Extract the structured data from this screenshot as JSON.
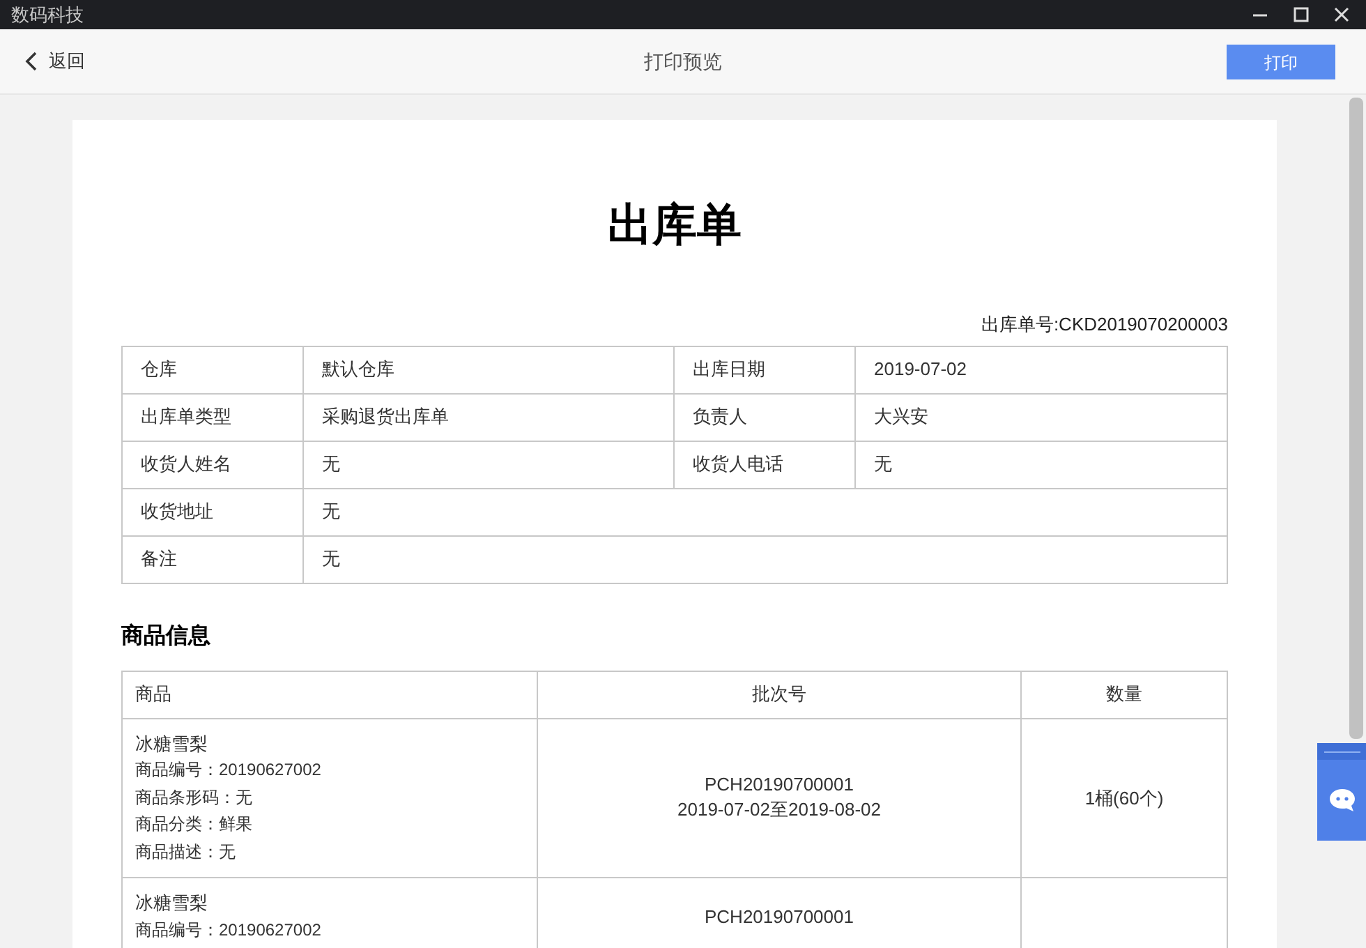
{
  "window": {
    "title": "数码科技"
  },
  "toolbar": {
    "back": "返回",
    "title": "打印预览",
    "print_button": "打印"
  },
  "document": {
    "title": "出库单",
    "order_number": "出库单号:CKD2019070200003",
    "info_rows": [
      {
        "cells": [
          "仓库",
          "默认仓库",
          "出库日期",
          "2019-07-02"
        ]
      },
      {
        "cells": [
          "出库单类型",
          "采购退货出库单",
          "负责人",
          "大兴安"
        ]
      },
      {
        "cells": [
          "收货人姓名",
          "无",
          "收货人电话",
          "无"
        ]
      },
      {
        "cells": [
          "收货地址",
          "无"
        ]
      },
      {
        "cells": [
          "备注",
          "无"
        ]
      }
    ],
    "goods_heading": "商品信息",
    "goods_table": {
      "columns": [
        "商品",
        "批次号",
        "数量"
      ],
      "rows": [
        {
          "product": [
            "冰糖雪梨",
            "商品编号：20190627002",
            "商品条形码：无",
            "商品分类：鲜果",
            "商品描述：无"
          ],
          "batch": [
            "PCH20190700001",
            "2019-07-02至2019-08-02"
          ],
          "quantity": "1桶(60个)"
        },
        {
          "product": [
            "冰糖雪梨",
            "商品编号：20190627002"
          ],
          "batch": [
            "PCH20190700001"
          ]
        }
      ]
    }
  }
}
